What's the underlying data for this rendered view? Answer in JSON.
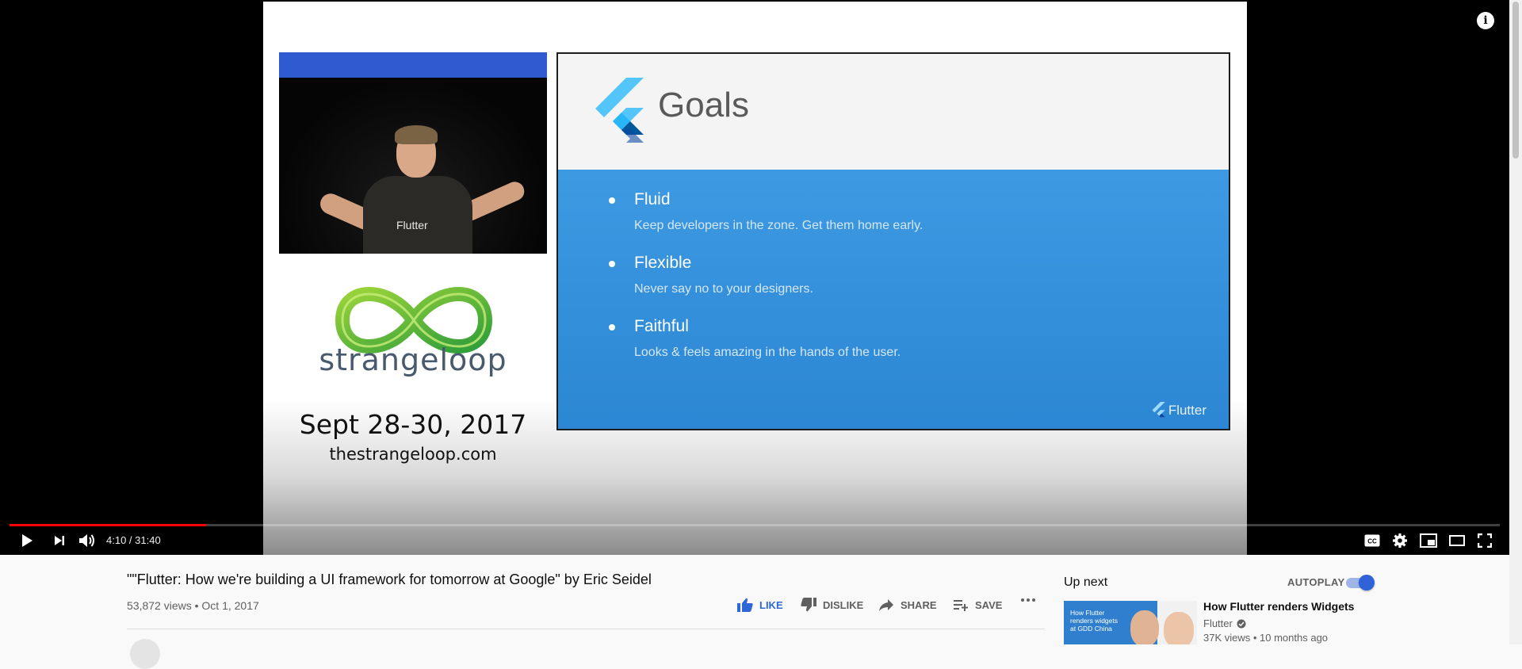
{
  "player": {
    "time_display": "4:10 / 31:40",
    "progress_fraction": 0.132,
    "colors": {
      "progress": "#ff0000",
      "slide_blue": "#2f89d6",
      "autoplay_blue": "#2f62d6"
    }
  },
  "video_content": {
    "speaker_shirt_text": "Flutter",
    "event_brand": "strangeloop",
    "event_dates": "Sept 28-30, 2017",
    "event_url": "thestrangeloop.com",
    "slide": {
      "title": "Goals",
      "items": [
        {
          "title": "Fluid",
          "description": "Keep developers in the zone. Get them home early."
        },
        {
          "title": "Flexible",
          "description": "Never say no to your designers."
        },
        {
          "title": "Faithful",
          "description": "Looks & feels amazing in the hands of the user."
        }
      ],
      "brand": "Flutter"
    }
  },
  "video": {
    "title": "\"\"Flutter: How we're building a UI framework for tomorrow at Google\" by Eric Seidel",
    "meta": "53,872 views • Oct 1, 2017",
    "actions": {
      "like": "LIKE",
      "dislike": "DISLIKE",
      "share": "SHARE",
      "save": "SAVE"
    }
  },
  "sidebar": {
    "up_next_label": "Up next",
    "autoplay_label": "AUTOPLAY",
    "autoplay_on": true,
    "recommendation": {
      "thumb_text": "How Flutter renders widgets at GDD China",
      "title": "How Flutter renders Widgets",
      "channel": "Flutter",
      "meta": "37K views • 10 months ago"
    }
  },
  "icons": [
    "play-icon",
    "next-icon",
    "volume-icon",
    "captions-icon",
    "settings-icon",
    "miniplayer-icon",
    "theater-icon",
    "fullscreen-icon",
    "info-icon",
    "like-icon",
    "dislike-icon",
    "share-icon",
    "save-icon",
    "more-icon",
    "verified-icon"
  ]
}
